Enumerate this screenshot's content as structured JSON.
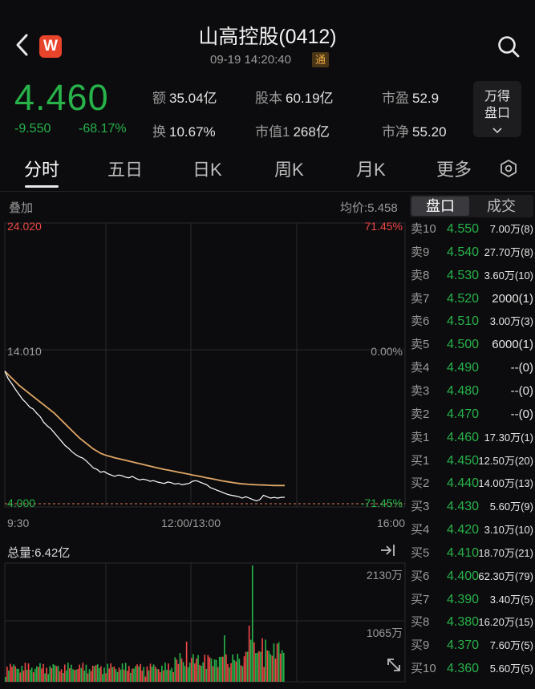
{
  "header": {
    "title": "山高控股(0412)",
    "datetime": "09-19  14:20:40",
    "badge": "通",
    "logo_letter": "W"
  },
  "quote": {
    "price": "4.460",
    "change": "-9.550",
    "change_pct": "-68.17%",
    "stats": [
      {
        "key": "额",
        "value": "35.04亿"
      },
      {
        "key": "股本",
        "value": "60.19亿"
      },
      {
        "key": "市盈",
        "value": "52.9"
      },
      {
        "key": "换",
        "value": "10.67%"
      },
      {
        "key": "市值1",
        "value": "268亿"
      },
      {
        "key": "市净",
        "value": "55.20"
      }
    ],
    "wande_button": [
      "万得",
      "盘口"
    ]
  },
  "tabs": [
    "分时",
    "五日",
    "日K",
    "周K",
    "月K",
    "更多"
  ],
  "chart": {
    "overlay_label": "叠加",
    "avg_price_label": "均价:5.458",
    "y_top": "24.020",
    "y_mid": "14.010",
    "y_bottom": "4.000",
    "pct_top": "71.45%",
    "pct_mid": "0.00%",
    "pct_bottom": "-71.45%",
    "x_start": "9:30",
    "x_mid": "12:00/13:00",
    "x_end": "16:00",
    "volume_label": "总量:6.42亿",
    "vol_top": "2130万",
    "vol_mid": "1065万"
  },
  "chart_data": {
    "type": "line",
    "price_range": [
      4.0,
      24.02
    ],
    "prev_close": 14.01,
    "price_series": [
      13.45,
      12.9,
      12.55,
      12.15,
      11.8,
      11.45,
      11.2,
      10.9,
      10.75,
      10.45,
      10.2,
      9.8,
      9.55,
      9.35,
      9.05,
      8.75,
      8.45,
      8.15,
      7.95,
      7.7,
      7.5,
      7.35,
      7.25,
      7.05,
      6.8,
      6.55,
      6.45,
      6.25,
      6.3,
      6.15,
      6.05,
      5.95,
      6.05,
      6.0,
      5.9,
      5.85,
      5.95,
      5.8,
      5.7,
      5.75,
      5.7,
      5.6,
      5.65,
      5.55,
      5.5,
      5.45,
      5.55,
      5.5,
      5.4,
      5.45,
      5.35,
      5.4,
      5.45,
      5.6,
      5.65,
      5.55,
      5.45,
      5.35,
      5.15,
      5.05,
      4.95,
      4.85,
      4.75,
      4.65,
      4.6,
      4.55,
      4.5,
      4.4,
      4.5,
      4.4,
      4.3,
      4.2,
      4.3,
      4.6,
      4.5,
      4.4,
      4.45,
      4.4,
      4.45,
      4.46
    ],
    "avg_series": [
      13.45,
      13.2,
      12.95,
      12.7,
      12.45,
      12.25,
      12.05,
      11.85,
      11.65,
      11.45,
      11.25,
      11.05,
      10.85,
      10.65,
      10.45,
      10.2,
      9.95,
      9.7,
      9.45,
      9.2,
      8.95,
      8.7,
      8.5,
      8.3,
      8.1,
      7.9,
      7.75,
      7.6,
      7.5,
      7.42,
      7.35,
      7.28,
      7.22,
      7.16,
      7.1,
      7.04,
      6.98,
      6.92,
      6.86,
      6.8,
      6.74,
      6.68,
      6.62,
      6.56,
      6.5,
      6.45,
      6.4,
      6.35,
      6.3,
      6.25,
      6.2,
      6.15,
      6.1,
      6.05,
      6.0,
      5.95,
      5.9,
      5.85,
      5.8,
      5.75,
      5.7,
      5.65,
      5.6,
      5.56,
      5.52,
      5.48,
      5.45,
      5.42,
      5.4,
      5.38,
      5.36,
      5.35,
      5.34,
      5.33,
      5.32,
      5.31,
      5.3,
      5.3,
      5.3,
      5.3
    ],
    "volume_max": 2130,
    "volume_unit": "万"
  },
  "orderbook": {
    "tab_active": "盘口",
    "tab_other": "成交",
    "rows": [
      {
        "label": "卖10",
        "price": "4.550",
        "vol": "7.00万(8)"
      },
      {
        "label": "卖9",
        "price": "4.540",
        "vol": "27.70万(8)"
      },
      {
        "label": "卖8",
        "price": "4.530",
        "vol": "3.60万(10)"
      },
      {
        "label": "卖7",
        "price": "4.520",
        "vol": "2000(1)"
      },
      {
        "label": "卖6",
        "price": "4.510",
        "vol": "3.00万(3)"
      },
      {
        "label": "卖5",
        "price": "4.500",
        "vol": "6000(1)"
      },
      {
        "label": "卖4",
        "price": "4.490",
        "vol": "--(0)"
      },
      {
        "label": "卖3",
        "price": "4.480",
        "vol": "--(0)"
      },
      {
        "label": "卖2",
        "price": "4.470",
        "vol": "--(0)"
      },
      {
        "label": "卖1",
        "price": "4.460",
        "vol": "17.30万(1)"
      },
      {
        "label": "买1",
        "price": "4.450",
        "vol": "12.50万(20)"
      },
      {
        "label": "买2",
        "price": "4.440",
        "vol": "14.00万(13)"
      },
      {
        "label": "买3",
        "price": "4.430",
        "vol": "5.60万(9)"
      },
      {
        "label": "买4",
        "price": "4.420",
        "vol": "3.10万(10)"
      },
      {
        "label": "买5",
        "price": "4.410",
        "vol": "18.70万(21)"
      },
      {
        "label": "买6",
        "price": "4.400",
        "vol": "62.30万(79)"
      },
      {
        "label": "买7",
        "price": "4.390",
        "vol": "3.40万(5)"
      },
      {
        "label": "买8",
        "price": "4.380",
        "vol": "16.20万(15)"
      },
      {
        "label": "买9",
        "price": "4.370",
        "vol": "7.60万(5)"
      },
      {
        "label": "买10",
        "price": "4.360",
        "vol": "5.60万(5)"
      }
    ]
  },
  "colors": {
    "up": "#ee4747",
    "down": "#27b24a",
    "avg_line": "#e0a767",
    "price_line": "#ffffff"
  }
}
